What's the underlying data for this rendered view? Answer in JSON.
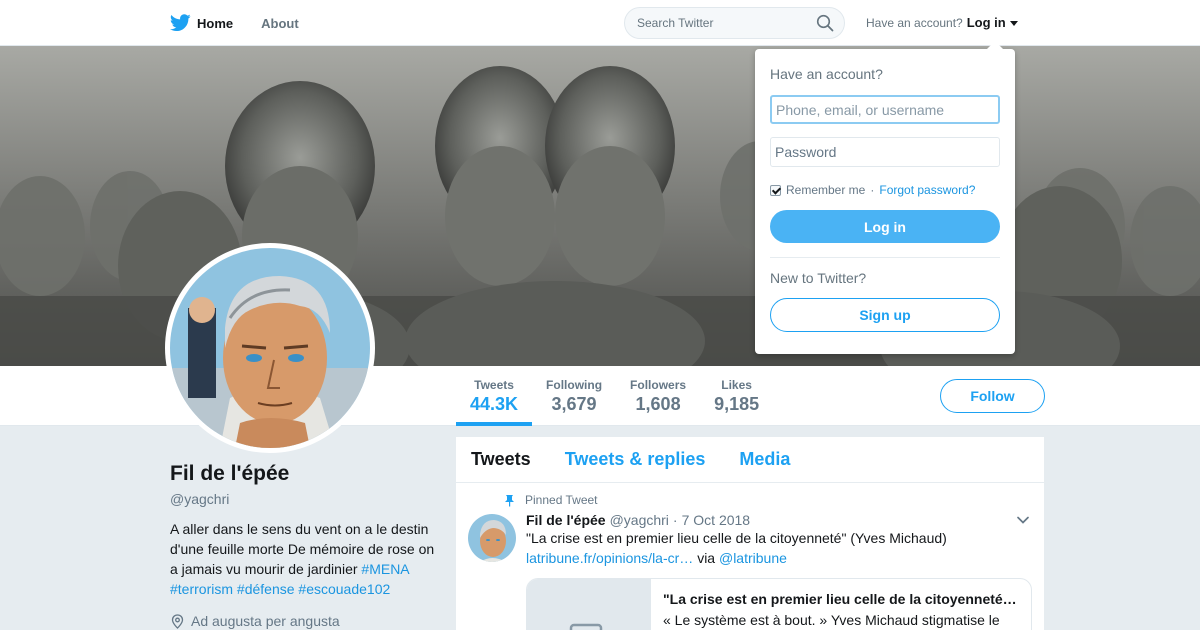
{
  "topbar": {
    "home_label": "Home",
    "about_label": "About",
    "search_placeholder": "Search Twitter",
    "have_account": "Have an account?",
    "login_link": "Log in"
  },
  "profile_nav": {
    "stats": [
      {
        "label": "Tweets",
        "value": "44.3K"
      },
      {
        "label": "Following",
        "value": "3,679"
      },
      {
        "label": "Followers",
        "value": "1,608"
      },
      {
        "label": "Likes",
        "value": "9,185"
      }
    ],
    "follow_label": "Follow"
  },
  "profile": {
    "name": "Fil de l'épée",
    "handle": "@yagchri",
    "bio_text": "A aller dans le sens du vent on a le destin d'une feuille morte De mémoire de rose on a jamais vu mourir de jardinier ",
    "bio_tags": [
      "#MENA",
      "#terrorism",
      "#défense",
      "#escouade102"
    ],
    "location": "Ad augusta per angusta"
  },
  "timeline": {
    "tabs": [
      "Tweets",
      "Tweets & replies",
      "Media"
    ],
    "pinned_label": "Pinned Tweet",
    "tweet": {
      "name": "Fil de l'épée",
      "handle": "@yagchri",
      "date": "7 Oct 2018",
      "text": "\"La crise est en premier lieu celle de la citoyenneté\" (Yves Michaud)",
      "link": "latribune.fr/opinions/la-cr…",
      "via": "via",
      "mention": "@latribune",
      "card_title": "\"La crise est en premier lieu celle de la citoyenneté…",
      "card_desc": "« Le système est à bout. » Yves Michaud stigmatise le"
    }
  },
  "login_dropdown": {
    "heading": "Have an account?",
    "username_placeholder": "Phone, email, or username",
    "password_placeholder": "Password",
    "remember_label": "Remember me",
    "separator": "·",
    "forgot_label": "Forgot password?",
    "login_button": "Log in",
    "new_to": "New to Twitter?",
    "signup_button": "Sign up"
  },
  "colors": {
    "brand": "#1da1f2",
    "link": "#1b95e0",
    "login_button": "#4ab3f4",
    "page_background": "#e6ecf0"
  },
  "icons": {
    "logo": "twitter-bird-icon",
    "search": "search-icon",
    "caret": "caret-down-icon",
    "pin": "pin-icon",
    "location": "location-pin-icon",
    "chevron": "chevron-down-icon",
    "checkbox": "checkbox-checked-icon"
  }
}
